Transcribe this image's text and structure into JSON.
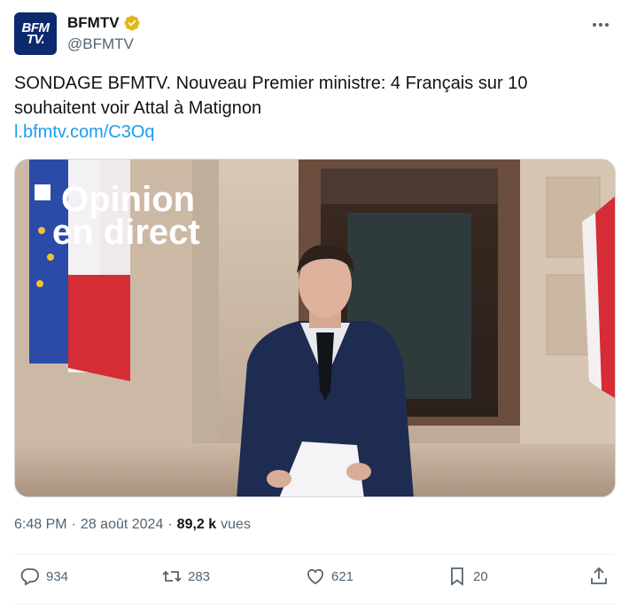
{
  "account": {
    "avatar_text_line1": "BFM",
    "avatar_text_line2": "TV.",
    "display_name": "BFMTV",
    "handle": "@BFMTV"
  },
  "tweet": {
    "text": "SONDAGE BFMTV. Nouveau Premier ministre: 4 Français sur 10 souhaitent voir Attal à Matignon",
    "link": "l.bfmtv.com/C3Oq"
  },
  "media": {
    "overlay_line1": "Opinion",
    "overlay_line2": "en direct"
  },
  "meta": {
    "time": "6:48 PM",
    "separator": "·",
    "date": "28 août 2024",
    "views_count": "89,2 k",
    "views_label": "vues"
  },
  "actions": {
    "replies": "934",
    "reposts": "283",
    "likes": "621",
    "bookmarks": "20"
  },
  "icons": {
    "verified": "verified-badge-icon",
    "more": "more-icon",
    "reply": "reply-icon",
    "repost": "repost-icon",
    "like": "heart-icon",
    "bookmark": "bookmark-icon",
    "share": "share-icon"
  },
  "colors": {
    "link": "#1d9bf0",
    "verified_gold": "#e2b719",
    "avatar_bg": "#0d2a6e",
    "secondary_text": "#536471"
  }
}
